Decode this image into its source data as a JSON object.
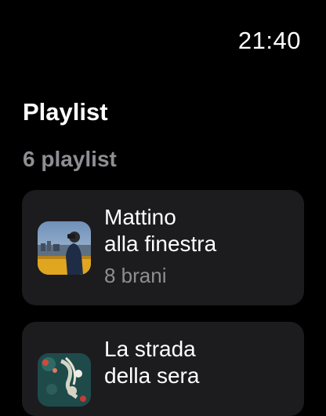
{
  "status": {
    "time": "21:40"
  },
  "header": {
    "title": "Playlist",
    "subtitle": "6 playlist"
  },
  "playlists": [
    {
      "title": "Mattino\nalla finestra",
      "tracks": "8 brani",
      "artwork": "person-window-photo-icon"
    },
    {
      "title": "La strada\ndella sera",
      "tracks": "",
      "artwork": "abstract-floral-art-icon"
    }
  ],
  "colors": {
    "background": "#000000",
    "card": "#1c1c1e",
    "secondary_text": "#8e8e93"
  }
}
